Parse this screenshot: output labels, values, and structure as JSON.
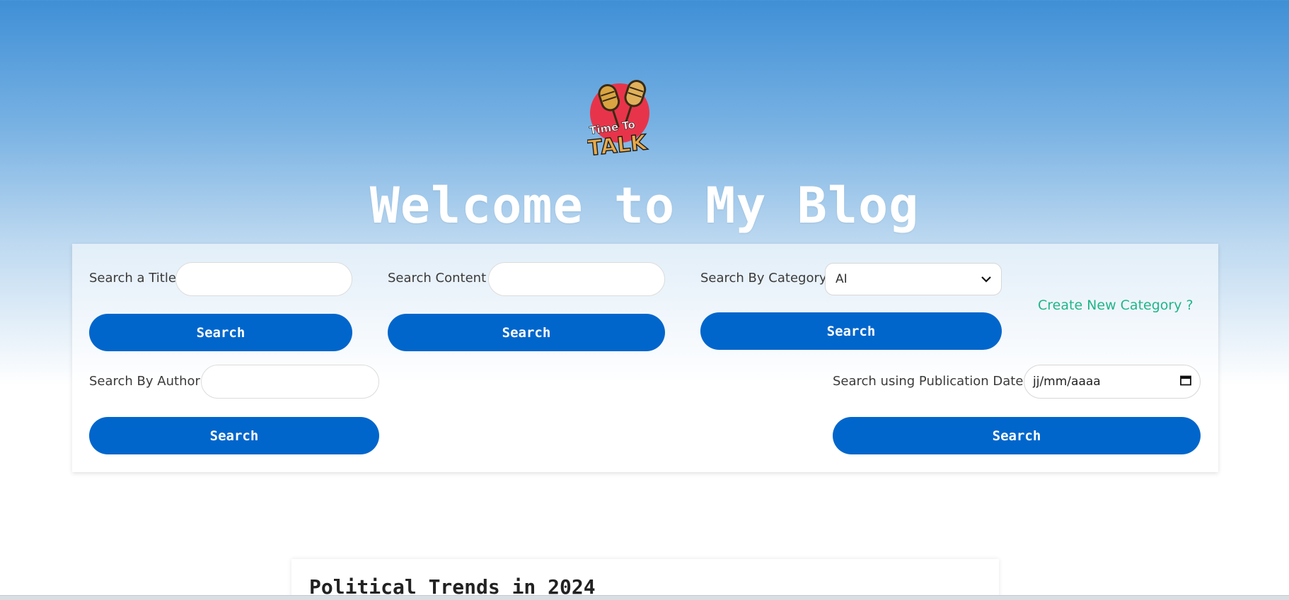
{
  "header": {
    "logo_line1": "Time To",
    "logo_line2": "TALK",
    "title": "Welcome to My Blog"
  },
  "search": {
    "title": {
      "label": "Search a Title",
      "value": "",
      "button": "Search"
    },
    "content": {
      "label": "Search Content",
      "value": "",
      "button": "Search"
    },
    "category": {
      "label": "Search By Category",
      "selected": "AI",
      "button": "Search"
    },
    "create_category": "Create New Category ?",
    "author": {
      "label": "Search By Author",
      "value": "",
      "button": "Search"
    },
    "date": {
      "label": "Search using Publication Date",
      "placeholder": "jj/mm/aaaa",
      "button": "Search"
    }
  },
  "posts": [
    {
      "title": "Political Trends in 2024"
    }
  ],
  "colors": {
    "primary": "#0066cc",
    "link": "#20b58a",
    "logo_red": "#e8344a",
    "logo_gold": "#d9a441"
  },
  "icons": {
    "logo": "microphones-logo",
    "select_arrow": "chevron-down-icon",
    "date": "calendar-icon"
  }
}
